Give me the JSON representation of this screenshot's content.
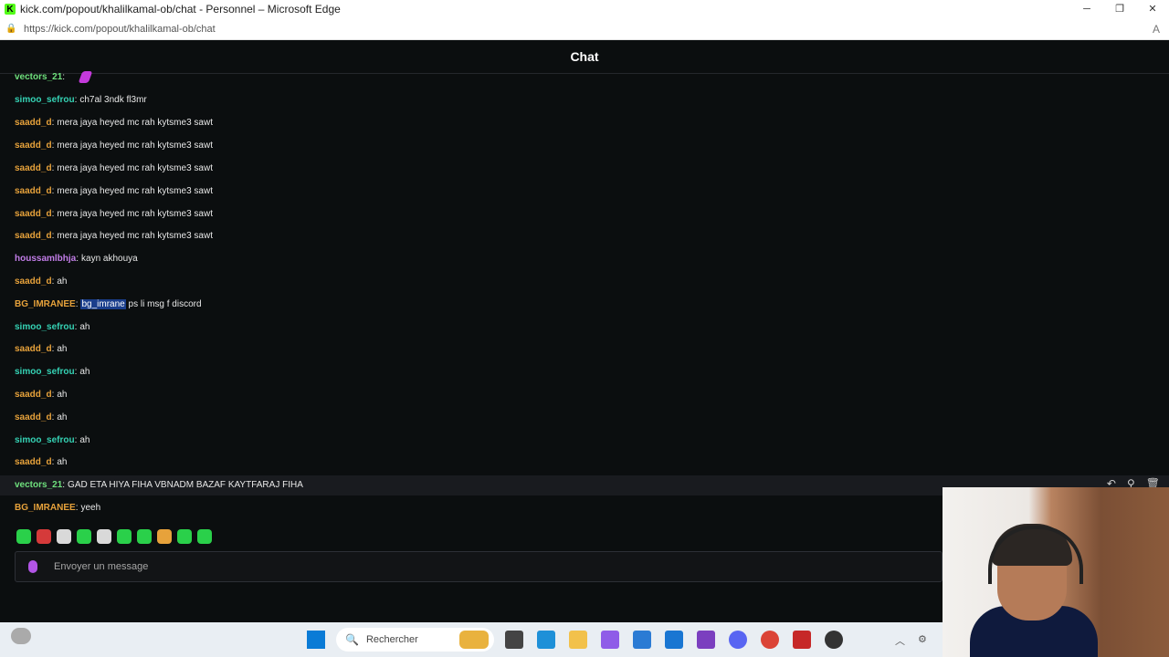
{
  "browser": {
    "window_title": "kick.com/popout/khalilkamal-ob/chat - Personnel – Microsoft Edge",
    "url": "https://kick.com/popout/khalilkamal-ob/chat",
    "favicon_letter": "K"
  },
  "chat": {
    "header": "Chat",
    "messages": [
      {
        "user": "vectors_21",
        "user_color": "#6fe07d",
        "text": "",
        "emote": "purple-emote"
      },
      {
        "user": "simoo_sefrou",
        "user_color": "#35d3b5",
        "text": "ch7al 3ndk fl3mr"
      },
      {
        "user": "saadd_d",
        "user_color": "#e7a23b",
        "text": "mera jaya heyed mc rah kytsme3 sawt"
      },
      {
        "user": "saadd_d",
        "user_color": "#e7a23b",
        "text": "mera jaya heyed mc rah kytsme3 sawt"
      },
      {
        "user": "saadd_d",
        "user_color": "#e7a23b",
        "text": "mera jaya heyed mc rah kytsme3 sawt"
      },
      {
        "user": "saadd_d",
        "user_color": "#e7a23b",
        "text": "mera jaya heyed mc rah kytsme3 sawt"
      },
      {
        "user": "saadd_d",
        "user_color": "#e7a23b",
        "text": "mera jaya heyed mc rah kytsme3 sawt"
      },
      {
        "user": "saadd_d",
        "user_color": "#e7a23b",
        "text": "mera jaya heyed mc rah kytsme3 sawt"
      },
      {
        "user": "houssamlbhja",
        "user_color": "#c27de8",
        "text": "kayn akhouya"
      },
      {
        "user": "saadd_d",
        "user_color": "#e7a23b",
        "text": "ah"
      },
      {
        "user": "BG_IMRANEE",
        "user_color": "#e7a23b",
        "mention": "bg_imrane",
        "text": "ps li msg f discord"
      },
      {
        "user": "simoo_sefrou",
        "user_color": "#35d3b5",
        "text": "ah"
      },
      {
        "user": "saadd_d",
        "user_color": "#e7a23b",
        "text": "ah"
      },
      {
        "user": "simoo_sefrou",
        "user_color": "#35d3b5",
        "text": "ah"
      },
      {
        "user": "saadd_d",
        "user_color": "#e7a23b",
        "text": "ah"
      },
      {
        "user": "saadd_d",
        "user_color": "#e7a23b",
        "text": "ah"
      },
      {
        "user": "simoo_sefrou",
        "user_color": "#35d3b5",
        "text": "ah"
      },
      {
        "user": "saadd_d",
        "user_color": "#e7a23b",
        "text": "ah"
      },
      {
        "user": "vectors_21",
        "user_color": "#6fe07d",
        "text": "GAD ETA HIYA FIHA VBNADM BAZAF KAYTFARAJ FIHA"
      },
      {
        "user": "BG_IMRANEE",
        "user_color": "#e7a23b",
        "text": "yeeh"
      }
    ],
    "input_placeholder": "Envoyer un message",
    "emote_bar": [
      "green-emote",
      "red-emote",
      "gray-emote",
      "green-emote",
      "gray-emote",
      "green-emote",
      "green-emote",
      "orange-emote",
      "green-emote",
      "green-emote"
    ]
  },
  "taskbar": {
    "search_placeholder": "Rechercher",
    "icons": [
      "file-explorer-icon",
      "edge-icon",
      "folder-icon",
      "copilot-icon",
      "store-icon",
      "outlook-icon",
      "clipchamp-icon",
      "discord-icon",
      "chrome-icon",
      "app-red-icon",
      "steam-icon"
    ]
  }
}
